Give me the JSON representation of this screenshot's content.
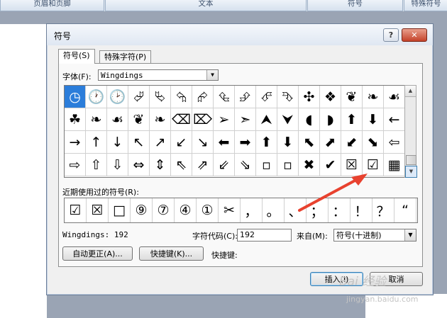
{
  "ribbon": {
    "tabs": [
      "页眉和页脚",
      "文本",
      "符号",
      "特殊符号"
    ]
  },
  "dialog": {
    "title": "符号",
    "help_label": "?",
    "close_label": "✕",
    "tabs": [
      "符号(S)",
      "特殊字符(P)"
    ],
    "font_label": "字体(F):",
    "font_value": "Wingdings",
    "grid_rows": [
      [
        "◷",
        "🕐",
        "🕑",
        "⮰",
        "⮱",
        "⮲",
        "⮳",
        "⮴",
        "⮵",
        "⮶",
        "⮷",
        "✣",
        "❖",
        "❦",
        "❧",
        "☙"
      ],
      [
        "☘",
        "❧",
        "☙",
        "❦",
        "❧",
        "⌫",
        "⌦",
        "➢",
        "➣",
        "⮝",
        "⮟",
        "◖",
        "◗",
        "⬆",
        "⬇",
        "←"
      ],
      [
        "→",
        "↑",
        "↓",
        "↖",
        "↗",
        "↙",
        "↘",
        "⬅",
        "➡",
        "⬆",
        "⬇",
        "⬉",
        "⬈",
        "⬋",
        "⬊",
        "⇦"
      ],
      [
        "⇨",
        "⇧",
        "⇩",
        "⇔",
        "⇕",
        "⇖",
        "⇗",
        "⇙",
        "⇘",
        "▫",
        "▫",
        "✖",
        "✔",
        "☒",
        "☑",
        "▦"
      ]
    ],
    "selected_index": [
      0,
      0
    ],
    "recent_label": "近期使用过的符号(R):",
    "recent_symbols": [
      "☑",
      "☒",
      "□",
      "⑨",
      "⑦",
      "④",
      "①",
      "✂",
      "，",
      "。",
      "、",
      "；",
      "：",
      "！",
      "？",
      "“"
    ],
    "info_text": "Wingdings: 192",
    "charcode_label": "字符代码(C):",
    "charcode_value": "192",
    "from_label": "来自(M):",
    "from_value": "符号(十进制)",
    "autocorrect_label": "自动更正(A)...",
    "shortcut_key_label": "快捷键(K)...",
    "shortcut_label": "快捷键:",
    "insert_label": "插入(I)",
    "cancel_label": "取消"
  },
  "watermark": {
    "logo": "Bai 经验",
    "url": "jingyan.baidu.com"
  },
  "colors": {
    "selection": "#2b7dda",
    "annotation_arrow": "#e8422f"
  }
}
